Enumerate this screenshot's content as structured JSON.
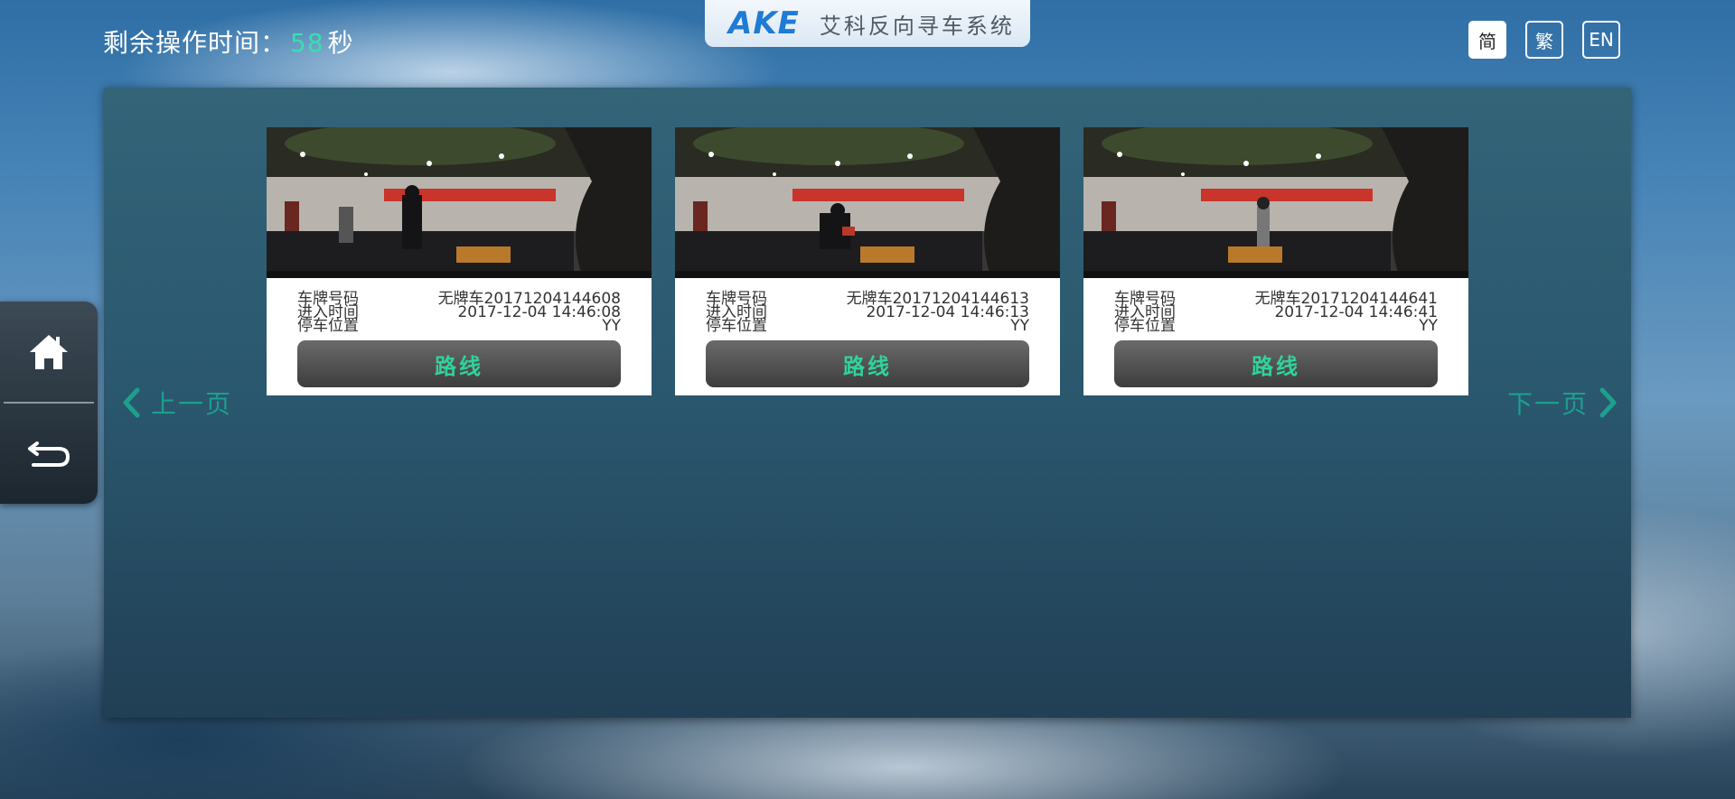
{
  "header": {
    "countdown_label": "剩余操作时间：",
    "countdown_value": "58",
    "countdown_unit": "秒",
    "logo": "AKE",
    "system_name": "艾科反向寻车系统"
  },
  "languages": [
    {
      "label": "简",
      "active": true
    },
    {
      "label": "繁",
      "active": false
    },
    {
      "label": "EN",
      "active": false
    }
  ],
  "sidebar": {
    "home_icon": "home-icon",
    "back_icon": "back-icon"
  },
  "pager": {
    "prev_label": "上一页",
    "next_label": "下一页"
  },
  "field_labels": {
    "plate": "车牌号码",
    "entry_time": "进入时间",
    "location": "停车位置"
  },
  "cards": [
    {
      "plate": "无牌车20171204144608",
      "entry_time": "2017-12-04 14:46:08",
      "location": "YY",
      "route_label": "路线"
    },
    {
      "plate": "无牌车20171204144613",
      "entry_time": "2017-12-04 14:46:13",
      "location": "YY",
      "route_label": "路线"
    },
    {
      "plate": "无牌车20171204144641",
      "entry_time": "2017-12-04 14:46:41",
      "location": "YY",
      "route_label": "路线"
    }
  ],
  "colors": {
    "accent": "#36e0b0",
    "route_text": "#2fd39b",
    "pager_text": "#1d9f8d",
    "logo_blue": "#1f7bd4"
  }
}
